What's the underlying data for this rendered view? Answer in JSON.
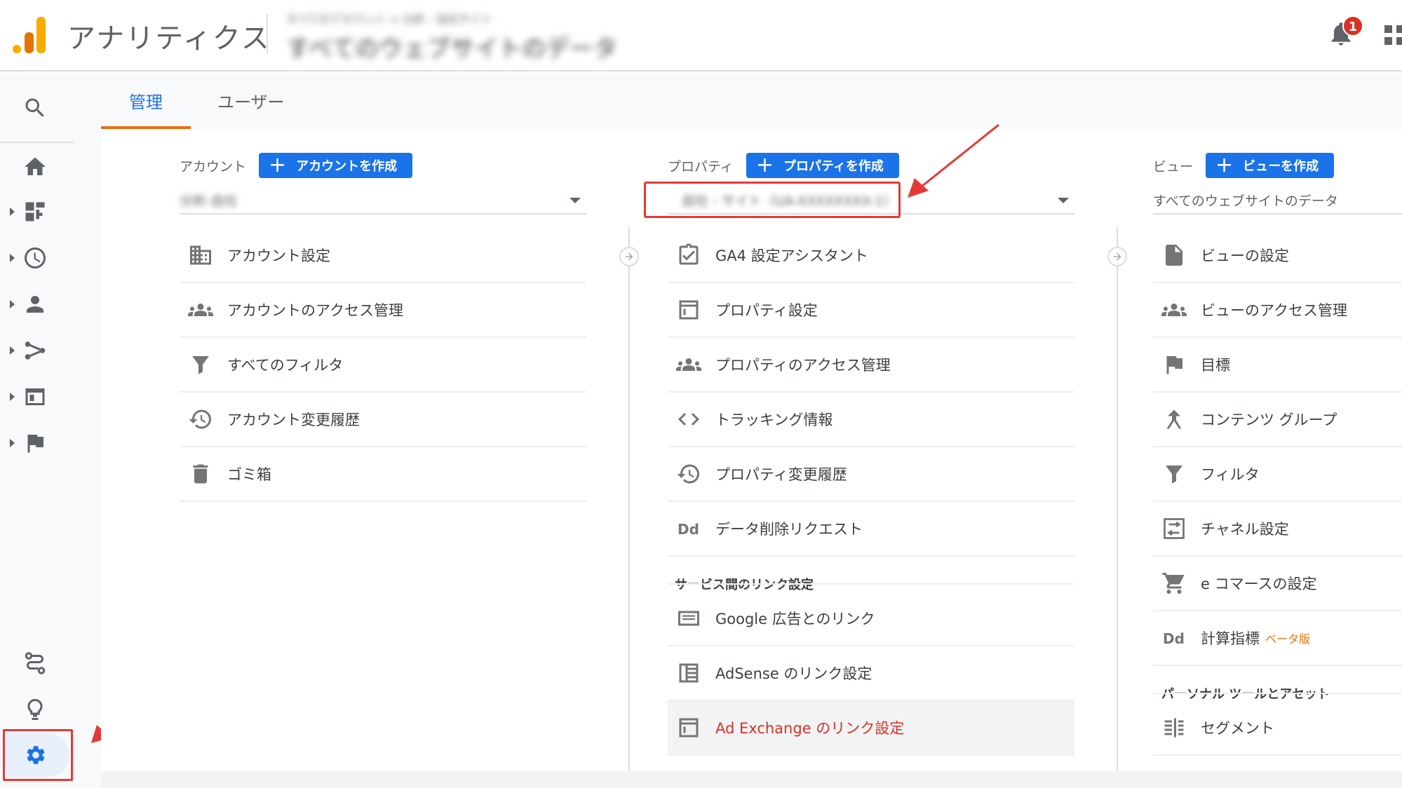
{
  "header": {
    "app_title": "アナリティクス",
    "property_crumb": "すべてのアカウント > 分析 - 自社サイト",
    "property_name": "すべてのウェブサイトのデータ",
    "notification_count": "1"
  },
  "tabs": [
    {
      "label": "管理"
    },
    {
      "label": "ユーザー"
    }
  ],
  "account": {
    "label": "アカウント",
    "create_label": "アカウントを作成",
    "selected": "分析-自社",
    "items": [
      {
        "label": "アカウント設定"
      },
      {
        "label": "アカウントのアクセス管理"
      },
      {
        "label": "すべてのフィルタ"
      },
      {
        "label": "アカウント変更履歴"
      },
      {
        "label": "ゴミ箱"
      }
    ]
  },
  "property": {
    "label": "プロパティ",
    "create_label": "プロパティを作成",
    "selected": "自社 - サイト（UA-XXXXXXXX-1）",
    "items": [
      {
        "label": "GA4 設定アシスタント"
      },
      {
        "label": "プロパティ設定"
      },
      {
        "label": "プロパティのアクセス管理"
      },
      {
        "label": "トラッキング情報"
      },
      {
        "label": "プロパティ変更履歴"
      },
      {
        "label": "データ削除リクエスト"
      }
    ],
    "link_section_title": "サービス間のリンク設定",
    "link_items": [
      {
        "label": "Google 広告とのリンク"
      },
      {
        "label": "AdSense のリンク設定"
      },
      {
        "label": "Ad Exchange のリンク設定"
      }
    ]
  },
  "view": {
    "label": "ビュー",
    "create_label": "ビューを作成",
    "selected": "すべてのウェブサイトのデータ",
    "items": [
      {
        "label": "ビューの設定"
      },
      {
        "label": "ビューのアクセス管理"
      },
      {
        "label": "目標"
      },
      {
        "label": "コンテンツ グループ"
      },
      {
        "label": "フィルタ"
      },
      {
        "label": "チャネル設定"
      },
      {
        "label": "e コマースの設定"
      },
      {
        "label": "計算指標",
        "badge": "ベータ版"
      }
    ],
    "personal_section_title": "パーソナル ツールとアセット",
    "personal_items": [
      {
        "label": "セグメント"
      }
    ]
  },
  "colors": {
    "accent": "#1a73e8",
    "tab_underline": "#e8710a",
    "annotation_red": "#e53935"
  }
}
